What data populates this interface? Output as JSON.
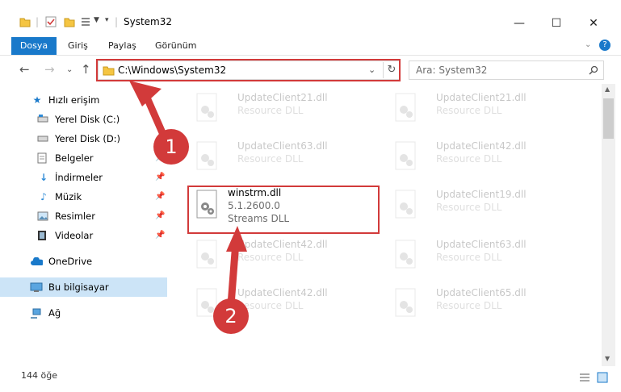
{
  "window": {
    "title": "System32",
    "minimize": "—",
    "maximize": "☐",
    "close": "✕"
  },
  "ribbon": {
    "tabs": [
      "Dosya",
      "Giriş",
      "Paylaş",
      "Görünüm"
    ],
    "help": "?"
  },
  "nav": {
    "address": "C:\\Windows\\System32",
    "search_placeholder": "Ara: System32"
  },
  "sidebar": {
    "items": [
      {
        "label": "Hızlı erişim"
      },
      {
        "label": "Yerel Disk (C:)"
      },
      {
        "label": "Yerel Disk (D:)"
      },
      {
        "label": "Belgeler"
      },
      {
        "label": "İndirmeler"
      },
      {
        "label": "Müzik"
      },
      {
        "label": "Resimler"
      },
      {
        "label": "Videolar"
      },
      {
        "label": "OneDrive"
      },
      {
        "label": "Bu bilgisayar"
      },
      {
        "label": "Ağ"
      }
    ]
  },
  "files": [
    {
      "name": "UpdateClient21.dll",
      "type": "Resource DLL"
    },
    {
      "name": "UpdateClient21.dll",
      "type": "Resource DLL"
    },
    {
      "name": "UpdateClient63.dll",
      "type": "Resource DLL"
    },
    {
      "name": "UpdateClient42.dll",
      "type": "Resource DLL"
    },
    {
      "name": "winstrm.dll",
      "version": "5.1.2600.0",
      "type": "Streams DLL"
    },
    {
      "name": "UpdateClient19.dll",
      "type": "Resource DLL"
    },
    {
      "name": "UpdateClient42.dll",
      "type": "Resource DLL"
    },
    {
      "name": "UpdateClient63.dll",
      "type": "Resource DLL"
    },
    {
      "name": "UpdateClient42.dll",
      "type": "Resource DLL"
    },
    {
      "name": "UpdateClient65.dll",
      "type": "Resource DLL"
    }
  ],
  "status": {
    "count": "144 öğe"
  },
  "annotations": {
    "step1": "1",
    "step2": "2"
  },
  "colors": {
    "accent": "#1979ca",
    "highlight": "#d23a3a",
    "selected": "#cce4f7"
  }
}
